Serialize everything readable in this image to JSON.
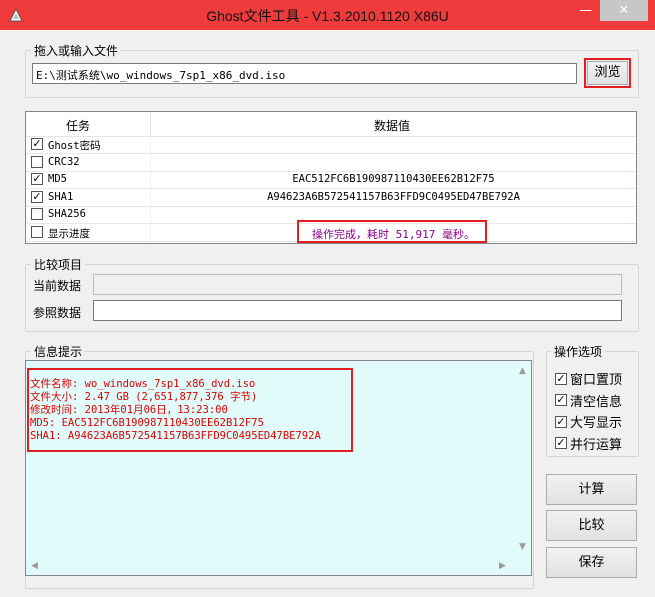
{
  "window": {
    "title": "Ghost文件工具 - V1.3.2010.1120 X86U",
    "minimize_glyph": "—",
    "close_glyph": "✕"
  },
  "file_group": {
    "label": "拖入或输入文件",
    "path": "E:\\测试系统\\wo_windows_7sp1_x86_dvd.iso",
    "browse_label": "浏览"
  },
  "task_table": {
    "col_task": "任务",
    "col_value": "数据值",
    "rows": [
      {
        "label": "Ghost密码",
        "checked": true,
        "value": ""
      },
      {
        "label": "CRC32",
        "checked": false,
        "value": ""
      },
      {
        "label": "MD5",
        "checked": true,
        "value": "EAC512FC6B190987110430EE62B12F75"
      },
      {
        "label": "SHA1",
        "checked": true,
        "value": "A94623A6B572541157B63FFD9C0495ED47BE792A"
      },
      {
        "label": "SHA256",
        "checked": false,
        "value": ""
      },
      {
        "label": "显示进度",
        "checked": false,
        "value": "操作完成，耗时 51,917 毫秒。"
      }
    ]
  },
  "compare_group": {
    "label": "比较项目",
    "current_label": "当前数据",
    "reference_label": "参照数据",
    "current_value": "",
    "reference_value": ""
  },
  "info_group": {
    "label": "信息提示",
    "lines": [
      "文件名称: wo_windows_7sp1_x86_dvd.iso",
      "文件大小: 2.47 GB (2,651,877,376 字节)",
      "修改时间: 2013年01月06日，13:23:00",
      "MD5: EAC512FC6B190987110430EE62B12F75",
      "SHA1: A94623A6B572541157B63FFD9C0495ED47BE792A"
    ]
  },
  "options_group": {
    "label": "操作选项",
    "items": [
      {
        "label": "窗口置顶",
        "checked": true
      },
      {
        "label": "清空信息",
        "checked": true
      },
      {
        "label": "大写显示",
        "checked": true
      },
      {
        "label": "并行运算",
        "checked": true
      }
    ]
  },
  "actions": {
    "calculate": "计算",
    "compare": "比较",
    "save": "保存"
  },
  "colors": {
    "titlebar": "#ef3b3b",
    "highlight_border": "#e02020",
    "status_text": "#8b008b",
    "info_text": "#e00000",
    "info_bg": "#e1fbfb"
  },
  "check_glyph": "✓"
}
